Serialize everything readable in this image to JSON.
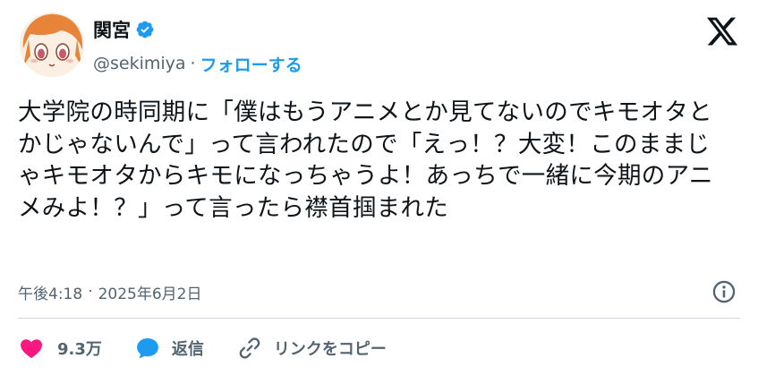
{
  "author": {
    "name": "関宮",
    "handle": "@sekimiya",
    "dot": "·",
    "follow_label": "フォローする"
  },
  "icons": {
    "avatar": "avatar",
    "verified": "verified-badge-icon",
    "brand": "x-logo-icon",
    "info": "info-icon",
    "like": "heart-icon",
    "reply": "reply-icon",
    "link": "link-icon"
  },
  "colors": {
    "accent": "#1d9bf0",
    "like": "#f91880",
    "muted": "#536471",
    "text": "#0f1419"
  },
  "tweet": {
    "text": "大学院の時同期に「僕はもうアニメとか見てないのでキモオタとかじゃないんで」って言われたので「えっ！？大変！このままじゃキモオタからキモになっちゃうよ！あっちで一緒に今期のアニメみよ！？」って言ったら襟首掴まれた",
    "time": "午後4:18",
    "sep": "·",
    "date": "2025年6月2日"
  },
  "actions": {
    "like_count": "9.3万",
    "reply_label": "返信",
    "copy_link_label": "リンクをコピー"
  }
}
